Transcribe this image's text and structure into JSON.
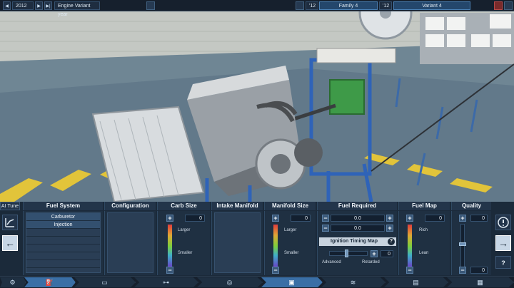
{
  "topbar": {
    "prev_label": "◀",
    "year": "2012",
    "next_label": "▶",
    "skip_label": "▶|",
    "title": "Engine Variant year",
    "family_year": "'12",
    "family": "Family 4",
    "variant_year": "'12",
    "variant": "Variant 4"
  },
  "left_panel": {
    "ai_tune": "AI Tune"
  },
  "columns": {
    "fuel_system": "Fuel System",
    "configuration": "Configuration",
    "carb_size": "Carb Size",
    "intake_manifold": "Intake Manifold",
    "manifold_size": "Manifold Size",
    "fuel_required": "Fuel Required",
    "fuel_map": "Fuel Map",
    "quality": "Quality"
  },
  "fuel_system": {
    "options": [
      "Carburetor",
      "Injection",
      "",
      "",
      "",
      "",
      ""
    ]
  },
  "carb_size": {
    "value": "0",
    "larger": "Larger",
    "smaller": "Smaller"
  },
  "manifold_size": {
    "value": "0",
    "larger": "Larger",
    "smaller": "Smaller"
  },
  "fuel_required": {
    "value1": "0.0",
    "value2": "0.0",
    "ignition_title": "Ignition Timing Map",
    "help": "?",
    "ignition_value": "0",
    "advanced": "Advanced",
    "retarded": "Retarded"
  },
  "fuel_map": {
    "value": "0",
    "rich": "Rich",
    "lean": "Lean"
  },
  "quality": {
    "top_value": "0",
    "bottom_value": "0"
  },
  "right_panel": {
    "help": "?"
  },
  "colors": {
    "accent": "#3a6fa6",
    "panel": "#1b2a3a"
  }
}
